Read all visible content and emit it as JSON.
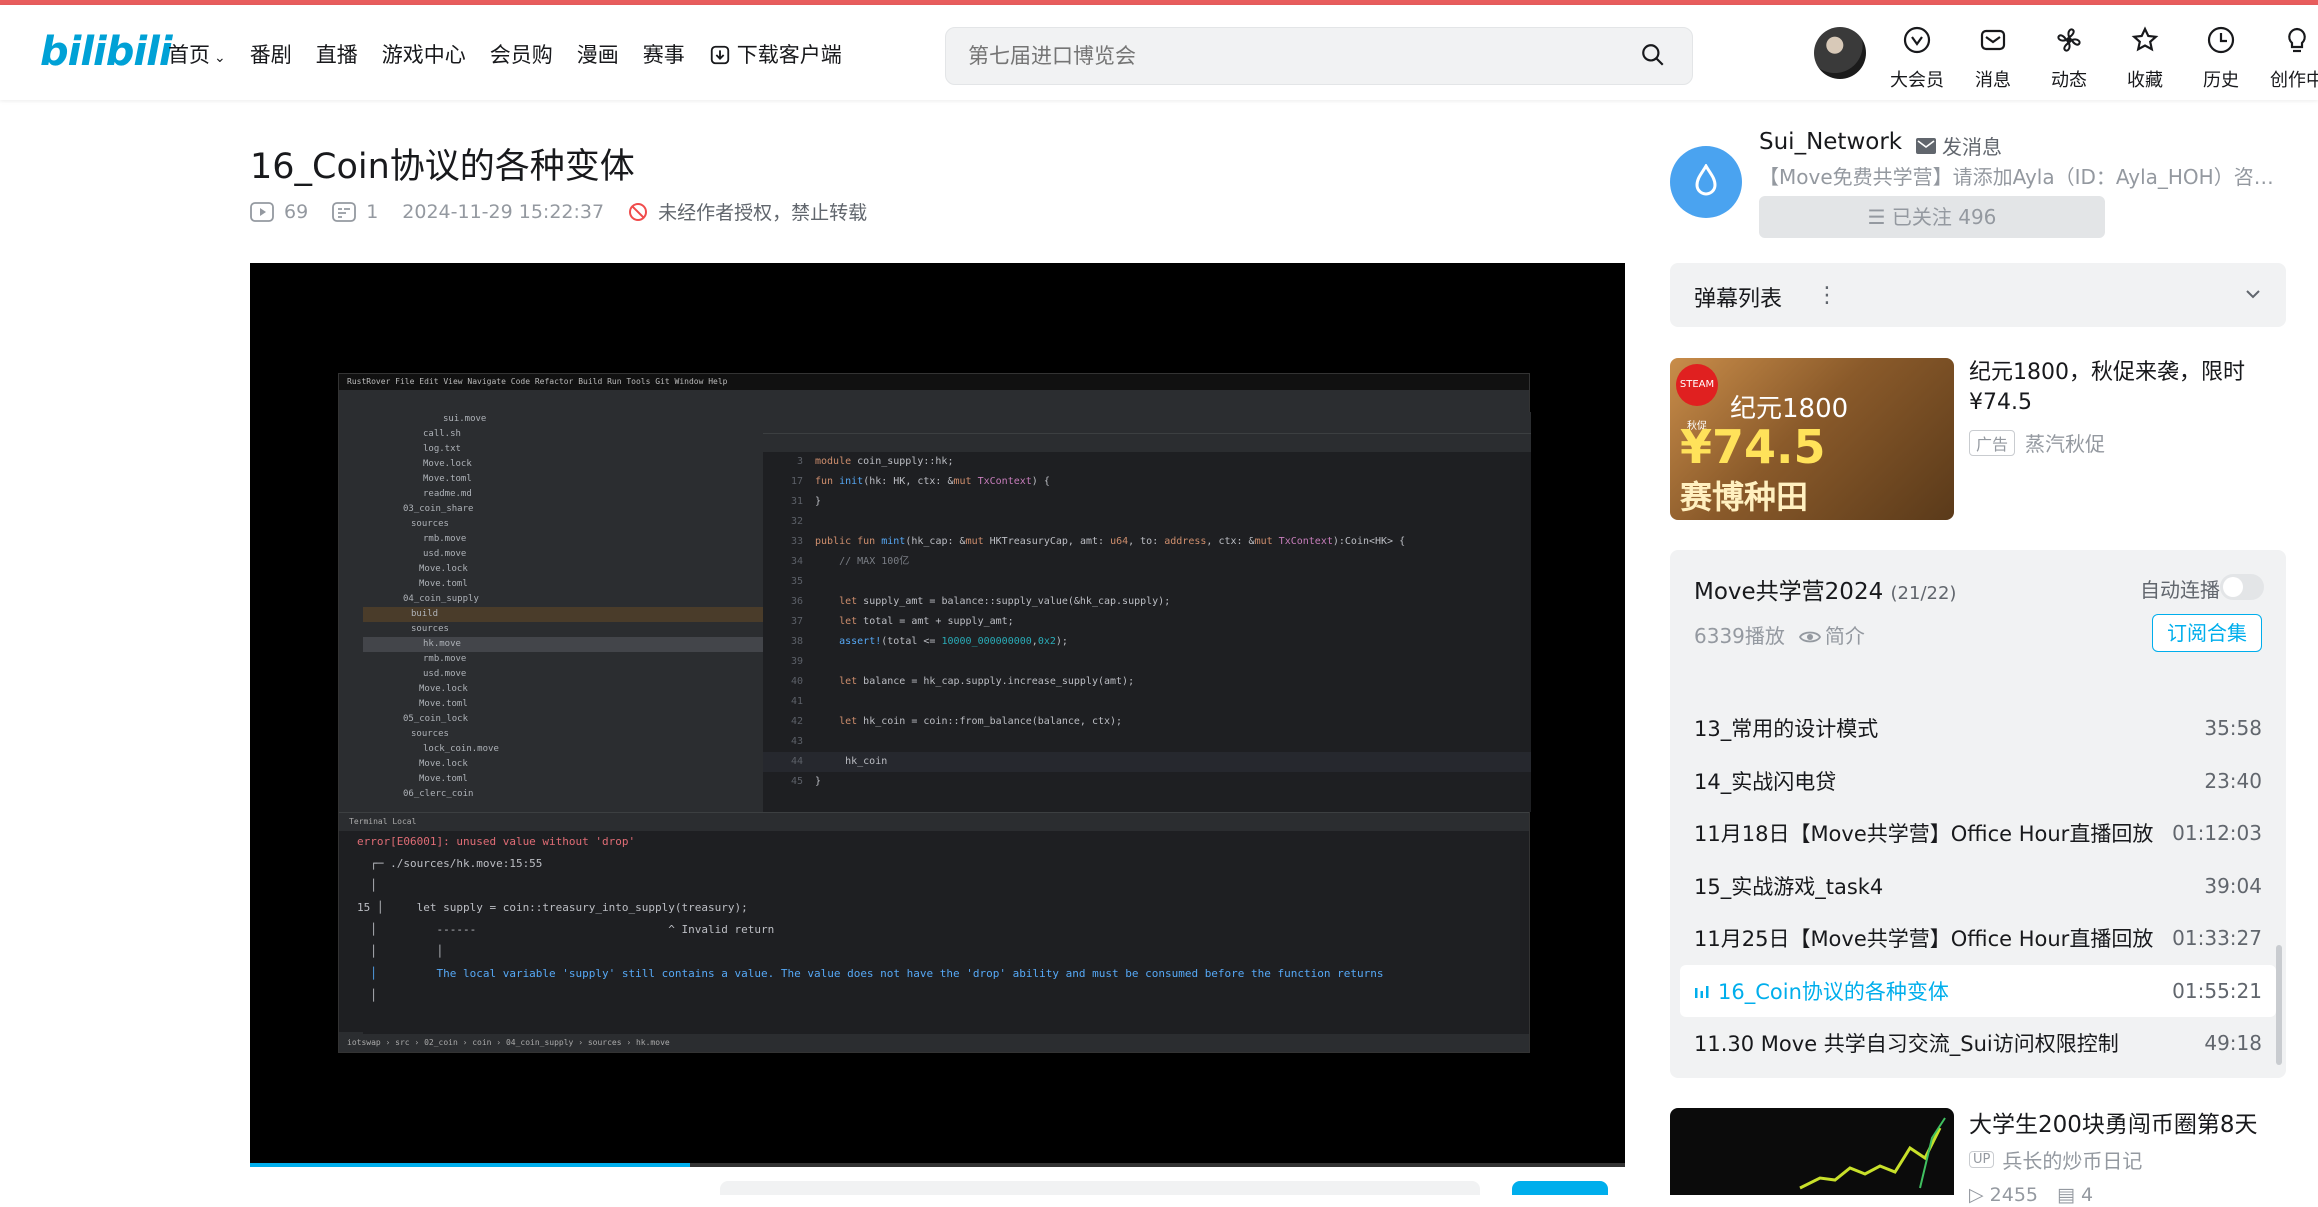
{
  "header": {
    "logo": "bilibili",
    "nav": [
      "首页",
      "番剧",
      "直播",
      "游戏中心",
      "会员购",
      "漫画",
      "赛事",
      "下载客户端"
    ],
    "search_placeholder": "第七届进口博览会",
    "icons": [
      {
        "icon": "vip-icon",
        "label": "大会员"
      },
      {
        "icon": "message-icon",
        "label": "消息"
      },
      {
        "icon": "dynamic-icon",
        "label": "动态"
      },
      {
        "icon": "star-icon",
        "label": "收藏"
      },
      {
        "icon": "clock-icon",
        "label": "历史"
      },
      {
        "icon": "bulb-icon",
        "label": "创作中"
      }
    ]
  },
  "video": {
    "title": "16_Coin协议的各种变体",
    "views": "69",
    "danmaku": "1",
    "date": "2024-11-29 15:22:37",
    "copyright": "未经作者授权，禁止转载",
    "progress": 0.32
  },
  "screen": {
    "menubar": "RustRover  File  Edit  View  Navigate  Code  Refactor  Build  Run  Tools  Git  Window  Help",
    "project": [
      "sui.move",
      "call.sh",
      "log.txt",
      "Move.lock",
      "Move.toml",
      "readme.md",
      "03_coin_share",
      "sources",
      "rmb.move",
      "usd.move",
      "Move.lock",
      "Move.toml",
      "04_coin_supply",
      "build",
      "sources",
      "hk.move",
      "rmb.move",
      "usd.move",
      "Move.lock",
      "Move.toml",
      "05_coin_lock",
      "sources",
      "lock_coin.move",
      "Move.lock",
      "Move.toml",
      "06_clerc_coin"
    ],
    "term_lines": [
      "error[E06001]: unused value without 'drop'",
      "  ┌─ ./sources/hk.move:15:55",
      "  │",
      "15 │     let supply = coin::treasury_into_supply(treasury);",
      "  │         ------                             ^ Invalid return",
      "  │         │",
      "  │         The local variable 'supply' still contains a value. The value does not have the 'drop' ability and must be consumed before the function returns",
      "  │"
    ]
  },
  "uploader": {
    "name": "Sui_Network",
    "message": "发消息",
    "desc": "【Move免费共学营】请添加Ayla（ID：Ayla_HOH）咨询报名",
    "follow": "已关注 496"
  },
  "danmaku_panel": {
    "label": "弹幕列表"
  },
  "ad": {
    "title": "纪元1800，秋促来袭，限时¥74.5",
    "badge": "广告",
    "source": "蒸汽秋促",
    "img_tag": "STEAM秋促",
    "img_head": "纪元1800",
    "img_price": "¥74.5",
    "img_sub": "赛博种田"
  },
  "collection": {
    "title": "Move共学营2024",
    "count": "(21/22)",
    "autoplay": "自动连播",
    "plays": "6339播放",
    "intro": "简介",
    "subscribe": "订阅合集",
    "episodes": [
      {
        "name": "13_常用的设计模式",
        "dur": "35:58"
      },
      {
        "name": "14_实战闪电贷",
        "dur": "23:40"
      },
      {
        "name": "11月18日【Move共学营】Office Hour直播回放",
        "dur": "01:12:03"
      },
      {
        "name": "15_实战游戏_task4",
        "dur": "39:04"
      },
      {
        "name": "11月25日【Move共学营】Office Hour直播回放",
        "dur": "01:33:27"
      },
      {
        "name": "16_Coin协议的各种变体",
        "dur": "01:55:21",
        "active": true
      },
      {
        "name": "11.30 Move 共学自习交流_Sui访问权限控制",
        "dur": "49:18"
      }
    ]
  },
  "recommend": {
    "title": "大学生200块勇闯币圈第8天",
    "up": "兵长的炒币日记",
    "up_badge": "UP",
    "views": "2455",
    "danmaku": "4"
  }
}
